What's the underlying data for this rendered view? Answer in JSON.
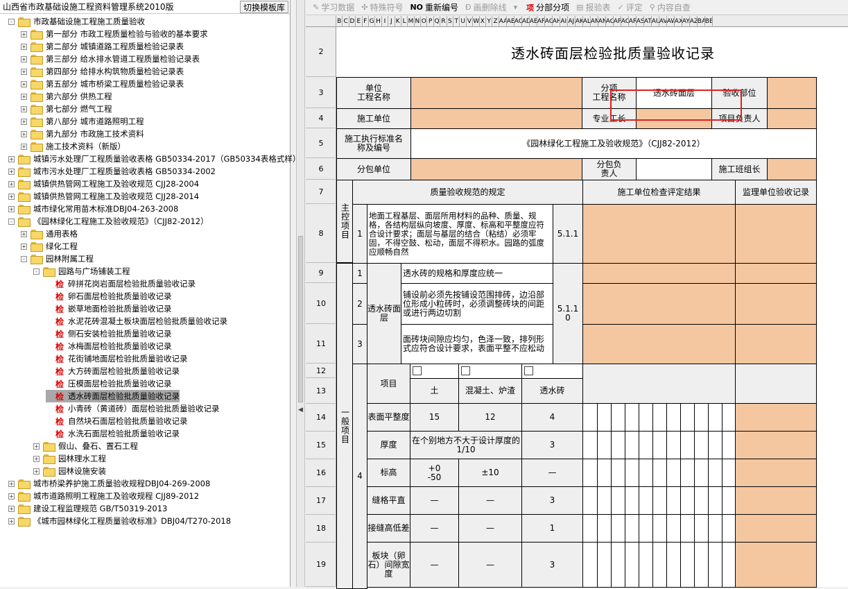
{
  "app": {
    "title": "山西省市政基础设施工程资料管理系统2010版",
    "switch_button": "切换模板库"
  },
  "tree": [
    {
      "level": 0,
      "exp": "-",
      "icon": "folder",
      "label": "市政基础设施工程施工质量验收"
    },
    {
      "level": 1,
      "exp": "+",
      "icon": "folder",
      "label": "第一部分 市政工程质量检验与验收的基本要求"
    },
    {
      "level": 1,
      "exp": "+",
      "icon": "folder",
      "label": "第二部分 城镇道路工程质量检验记录表"
    },
    {
      "level": 1,
      "exp": "+",
      "icon": "folder",
      "label": "第三部分 给水排水管道工程质量检验记录表"
    },
    {
      "level": 1,
      "exp": "+",
      "icon": "folder",
      "label": "第四部分 给排水构筑物质量检验记录表"
    },
    {
      "level": 1,
      "exp": "+",
      "icon": "folder",
      "label": "第五部分 城市桥梁工程质量检验记录表"
    },
    {
      "level": 1,
      "exp": "+",
      "icon": "folder",
      "label": "第六部分 供热工程"
    },
    {
      "level": 1,
      "exp": "+",
      "icon": "folder",
      "label": "第七部分 燃气工程"
    },
    {
      "level": 1,
      "exp": "+",
      "icon": "folder",
      "label": "第八部分 城市道路照明工程"
    },
    {
      "level": 1,
      "exp": "+",
      "icon": "folder",
      "label": "第九部分 市政施工技术资料"
    },
    {
      "level": 1,
      "exp": "+",
      "icon": "folder",
      "label": "施工技术资料（新版）"
    },
    {
      "level": 0,
      "exp": "+",
      "icon": "folder",
      "label": "城镇污水处理厂工程质量验收表格 GB50334-2017（GB50334表格式样）"
    },
    {
      "level": 0,
      "exp": "+",
      "icon": "folder",
      "label": "城市污水处理厂工程质量验收表格 GB50334-2002"
    },
    {
      "level": 0,
      "exp": "+",
      "icon": "folder",
      "label": "城镇供热管网工程施工及验收规范 CJJ28-2004"
    },
    {
      "level": 0,
      "exp": "+",
      "icon": "folder",
      "label": "城镇供热管网工程施工及验收规范 CJJ28-2014"
    },
    {
      "level": 0,
      "exp": "+",
      "icon": "folder",
      "label": "城市绿化常用苗木标准DBJ04-263-2008"
    },
    {
      "level": 0,
      "exp": "-",
      "icon": "folder",
      "label": "《园林绿化工程施工及验收规范》（CJJ82-2012）"
    },
    {
      "level": 1,
      "exp": "+",
      "icon": "folder",
      "label": "通用表格"
    },
    {
      "level": 1,
      "exp": "+",
      "icon": "folder",
      "label": "绿化工程"
    },
    {
      "level": 1,
      "exp": "-",
      "icon": "folder",
      "label": "园林附属工程"
    },
    {
      "level": 2,
      "exp": "-",
      "icon": "folder",
      "label": "园路与广场铺装工程"
    },
    {
      "level": 3,
      "exp": "",
      "icon": "jian",
      "label": "碎拼花岗岩面层检验批质量验收记录"
    },
    {
      "level": 3,
      "exp": "",
      "icon": "jian",
      "label": "卵石面层检验批质量验收记录"
    },
    {
      "level": 3,
      "exp": "",
      "icon": "jian",
      "label": "嵌草地面检验批质量验收记录"
    },
    {
      "level": 3,
      "exp": "",
      "icon": "jian",
      "label": "水泥花砖混凝土板块面层检验批质量验收记录"
    },
    {
      "level": 3,
      "exp": "",
      "icon": "jian",
      "label": "侧石安装检验批质量验收记录"
    },
    {
      "level": 3,
      "exp": "",
      "icon": "jian",
      "label": "冰梅面层检验批质量验收记录"
    },
    {
      "level": 3,
      "exp": "",
      "icon": "jian",
      "label": "花街铺地面层检验批质量验收记录"
    },
    {
      "level": 3,
      "exp": "",
      "icon": "jian",
      "label": "大方砖面层检验批质量验收记录"
    },
    {
      "level": 3,
      "exp": "",
      "icon": "jian",
      "label": "压模面层检验批质量验收记录"
    },
    {
      "level": 3,
      "exp": "",
      "icon": "jian",
      "label": "透水砖面层检验批质量验收记录",
      "selected": true
    },
    {
      "level": 3,
      "exp": "",
      "icon": "jian",
      "label": "小青砖（黄道砖）面层检验批质量验收记录"
    },
    {
      "level": 3,
      "exp": "",
      "icon": "jian",
      "label": "自然块石面层检验批质量验收记录"
    },
    {
      "level": 3,
      "exp": "",
      "icon": "jian",
      "label": "水洗石面层检验批质量验收记录"
    },
    {
      "level": 2,
      "exp": "+",
      "icon": "folder",
      "label": "假山、叠石、置石工程"
    },
    {
      "level": 2,
      "exp": "+",
      "icon": "folder",
      "label": "园林理水工程"
    },
    {
      "level": 2,
      "exp": "+",
      "icon": "folder",
      "label": "园林设施安装"
    },
    {
      "level": 0,
      "exp": "+",
      "icon": "folder",
      "label": "城市桥梁养护施工质量验收规程DBJ04-269-2008"
    },
    {
      "level": 0,
      "exp": "+",
      "icon": "folder",
      "label": "城市道路照明工程施工及验收规程 CJJ89-2012"
    },
    {
      "level": 0,
      "exp": "+",
      "icon": "folder",
      "label": "建设工程监理规范 GB/T50319-2013"
    },
    {
      "level": 0,
      "exp": "+",
      "icon": "folder",
      "label": "《城市园林绿化工程质量验收标准》DBJ04/T270-2018"
    }
  ],
  "toolbar": [
    {
      "icon": "✎",
      "label": "学习数据",
      "enabled": false
    },
    {
      "icon": "✣",
      "label": "特殊符号",
      "enabled": false
    },
    {
      "icon": "NO",
      "label": "重新编号",
      "enabled": true
    },
    {
      "icon": "Ð",
      "label": "画删除线",
      "enabled": false
    },
    {
      "icon": "▾",
      "label": "",
      "enabled": false
    },
    {
      "icon": "项",
      "label": "分部分项",
      "enabled": true
    },
    {
      "icon": "▤",
      "label": "报验表",
      "enabled": false
    },
    {
      "icon": "✓",
      "label": "评定",
      "enabled": false
    },
    {
      "icon": "⚲",
      "label": "内容自查",
      "enabled": false
    }
  ],
  "columns": [
    "B",
    "C",
    "D",
    "E",
    "F",
    "G",
    "H",
    "I",
    "J",
    "K",
    "L",
    "M",
    "N",
    "O",
    "P",
    "Q",
    "R",
    "S",
    "T",
    "U",
    "V",
    "W",
    "X",
    "Y",
    "Z",
    "AA",
    "AB",
    "AC",
    "AD",
    "AE",
    "AF",
    "AG",
    "AH",
    "AI",
    "AJ",
    "AK",
    "AL",
    "AM",
    "AN",
    "AO",
    "AP",
    "AQ",
    "AR",
    "AS",
    "AT",
    "AU",
    "AV",
    "AW",
    "AX",
    "AY",
    "AZ",
    "BA",
    "BB"
  ],
  "rows": [
    "2",
    "3",
    "4",
    "5",
    "6",
    "7",
    "8",
    "9",
    "10",
    "11",
    "12",
    "13",
    "14",
    "15",
    "16",
    "17",
    "18",
    "19"
  ],
  "form": {
    "title": "透水砖面层检验批质量验收记录",
    "unit_project": "单位\n工程名称",
    "sub_project": "分项\n工程名称",
    "sub_project_value": "透水砖面层",
    "acceptance_part": "验收部位",
    "construction_unit": "施工单位",
    "foreman": "专业工长",
    "project_manager": "项目负责人",
    "standard_label": "施工执行标准名\n称及编号",
    "standard_value": "《园林绿化工程施工及验收规范》（CJJ82-2012）",
    "subcontractor": "分包单位",
    "sub_manager": "分包负\n责人",
    "team_leader": "施工班组长",
    "col_spec": "质量验收规范的规定",
    "col_check": "施工单位检查评定结果",
    "col_supervise": "监理单位验收记录",
    "main_item": "主控项目",
    "item1_no": "1",
    "item1_text": "地面工程基层、面层所用材料的品种、质量、规格，各结构层纵向坡度、厚度、标高和平整度应符合设计要求；面层与基层的结合（粘结）必须牢固，不得空鼓、松动，面层不得积水。园路的弧度应顺畅自然",
    "item1_clause": "5.1.1",
    "general_item": "一般项目",
    "g1_no": "1",
    "g2_no": "2",
    "g3_no": "3",
    "g4_no": "4",
    "g_group": "透水砖面层",
    "g1_text": "透水砖的规格和厚度应统一",
    "g2_text": "铺设前必须先按铺设范围排砖，边沿部位形成小粒砖时，必须调整砖块的间距或进行两边切割",
    "g3_text": "面砖块间隙应均匀，色泽一致，排列形式应符合设计要求，表面平整不应松动",
    "g_clause": "5.1.10",
    "tol_item": "项目",
    "tol_col1": "土",
    "tol_col2": "混凝土、炉渣",
    "tol_col3": "透水砖",
    "tol_rows": [
      {
        "name": "表面平整度",
        "v1": "15",
        "v2": "12",
        "v3": "4"
      },
      {
        "name": "厚度",
        "v1": "在个别地方不大于设计厚度的1/10",
        "v2": "",
        "v3": "3"
      },
      {
        "name": "标高",
        "v1": "+0\n-50",
        "v2": "±10",
        "v3": "—"
      },
      {
        "name": "缝格平直",
        "v1": "—",
        "v2": "—",
        "v3": "3"
      },
      {
        "name": "接缝高低差",
        "v1": "—",
        "v2": "—",
        "v3": "1"
      },
      {
        "name": "板块（卵石）间隙宽度",
        "v1": "—",
        "v2": "—",
        "v3": "3"
      }
    ]
  },
  "colors": {
    "orange": "#f4c7a1",
    "highlight": "#e02020",
    "selected": "#a8a8a8"
  }
}
